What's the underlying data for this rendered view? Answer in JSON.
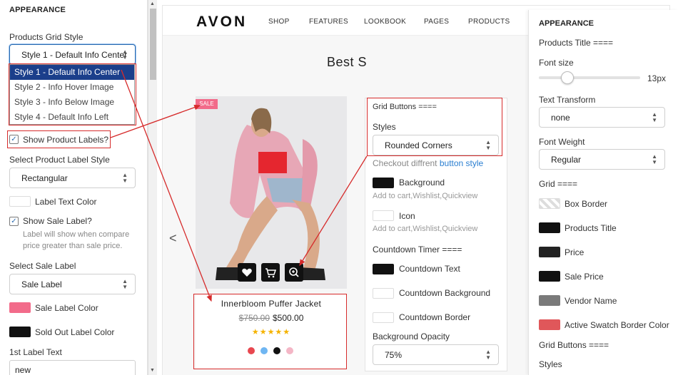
{
  "left_panel": {
    "heading": "APPEARANCE",
    "grid_style_label": "Products Grid Style",
    "grid_style_value": "Style 1 - Default Info Center",
    "grid_style_options": [
      "Style 1 - Default Info Center",
      "Style 2 - Info Hover Image",
      "Style 3 - Info Below Image",
      "Style 4 - Default Info Left"
    ],
    "show_labels": "Show Product Labels?",
    "label_style_label": "Select Product Label Style",
    "label_style_value": "Rectangular",
    "label_text_color": "Label Text Color",
    "show_sale": "Show Sale Label?",
    "sale_hint": "Label will show when compare price greater than sale price.",
    "select_sale_label": "Select Sale Label",
    "sale_label_value": "Sale Label",
    "sale_label_color": "Sale Label Color",
    "sold_out_color": "Sold Out Label Color",
    "first_label_text": "1st Label Text",
    "first_label_value": "new"
  },
  "preview": {
    "logo": "AVON",
    "menu": [
      "SHOP",
      "FEATURES",
      "LOOKBOOK",
      "PAGES",
      "PRODUCTS"
    ],
    "section_title": "Best S",
    "sale_badge": "SALE",
    "product_title": "Innerbloom Puffer Jacket",
    "old_price": "$750.00",
    "new_price": "$500.00",
    "stars": "★★★★★",
    "swatches": [
      "#e8474f",
      "#6fb6f2",
      "#111111",
      "#f4b6c6"
    ]
  },
  "middle_panel": {
    "grid_buttons": "Grid Buttons ====",
    "styles_label": "Styles",
    "styles_value": "Rounded Corners",
    "checkout_text": "Checkout diffrent",
    "checkout_link": "button style",
    "background": "Background",
    "bg_hint": "Add to cart,Wishlist,Quickview",
    "icon": "Icon",
    "icon_hint": "Add to cart,Wishlist,Quickview",
    "countdown": "Countdown Timer ====",
    "countdown_text": "Countdown Text",
    "countdown_bg": "Countdown Background",
    "countdown_border": "Countdown Border",
    "bg_opacity": "Background Opacity",
    "bg_opacity_value": "75%"
  },
  "right_panel": {
    "heading": "APPEARANCE",
    "products_title": "Products Title ====",
    "font_size": "Font size",
    "font_size_value": "13px",
    "font_size_slider": 0.28,
    "text_transform": "Text Transform",
    "text_transform_value": "none",
    "font_weight": "Font Weight",
    "font_weight_value": "Regular",
    "grid": "Grid ====",
    "box_border": "Box Border",
    "products_title_c": "Products Title",
    "price": "Price",
    "sale_price": "Sale Price",
    "vendor_name": "Vendor Name",
    "active_swatch": "Active Swatch Border Color",
    "grid_buttons": "Grid Buttons ====",
    "styles": "Styles"
  },
  "colors": {
    "accent": "#d62b2b",
    "link": "#2b7fd1",
    "sale_pink": "#f26b8a",
    "swatch_red": "#e0575a",
    "swatch_grey": "#7a7a7a"
  }
}
